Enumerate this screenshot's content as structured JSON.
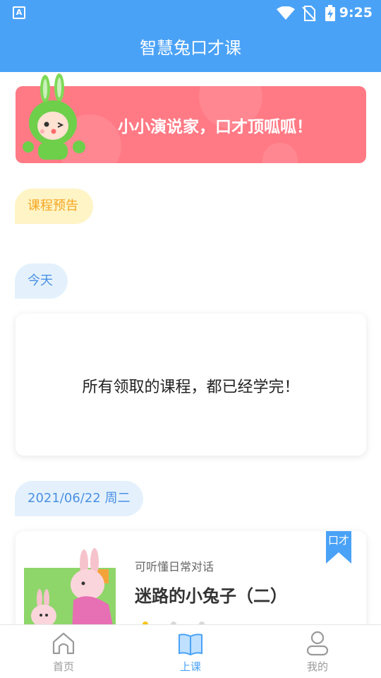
{
  "status_bar": {
    "time": "9:25",
    "icons": [
      "app-notification-icon",
      "wifi-icon",
      "no-sim-icon",
      "battery-charging-icon"
    ]
  },
  "header": {
    "title": "智慧兔口才课"
  },
  "banner": {
    "slogan": "小小演说家，口才顶呱呱！",
    "mascot_icon": "bunny-mascot"
  },
  "sections": {
    "preview_label": "课程预告",
    "today_label": "今天",
    "empty_message": "所有领取的课程，都已经学完！",
    "date_label": "2021/06/22 周二"
  },
  "course": {
    "subtitle": "可听懂日常对话",
    "title": "迷路的小兔子（二）",
    "tag": "口才"
  },
  "tabbar": {
    "items": [
      {
        "label": "首页",
        "icon": "home-icon",
        "active": false
      },
      {
        "label": "上课",
        "icon": "book-icon",
        "active": true
      },
      {
        "label": "我的",
        "icon": "profile-icon",
        "active": false
      }
    ]
  },
  "colors": {
    "primary": "#4aa2f7",
    "banner": "#ff7a85",
    "preview_pill": "#fff4c6",
    "preview_text": "#f5a623",
    "date_pill": "#e4f1fd",
    "date_text": "#4a90e2"
  }
}
